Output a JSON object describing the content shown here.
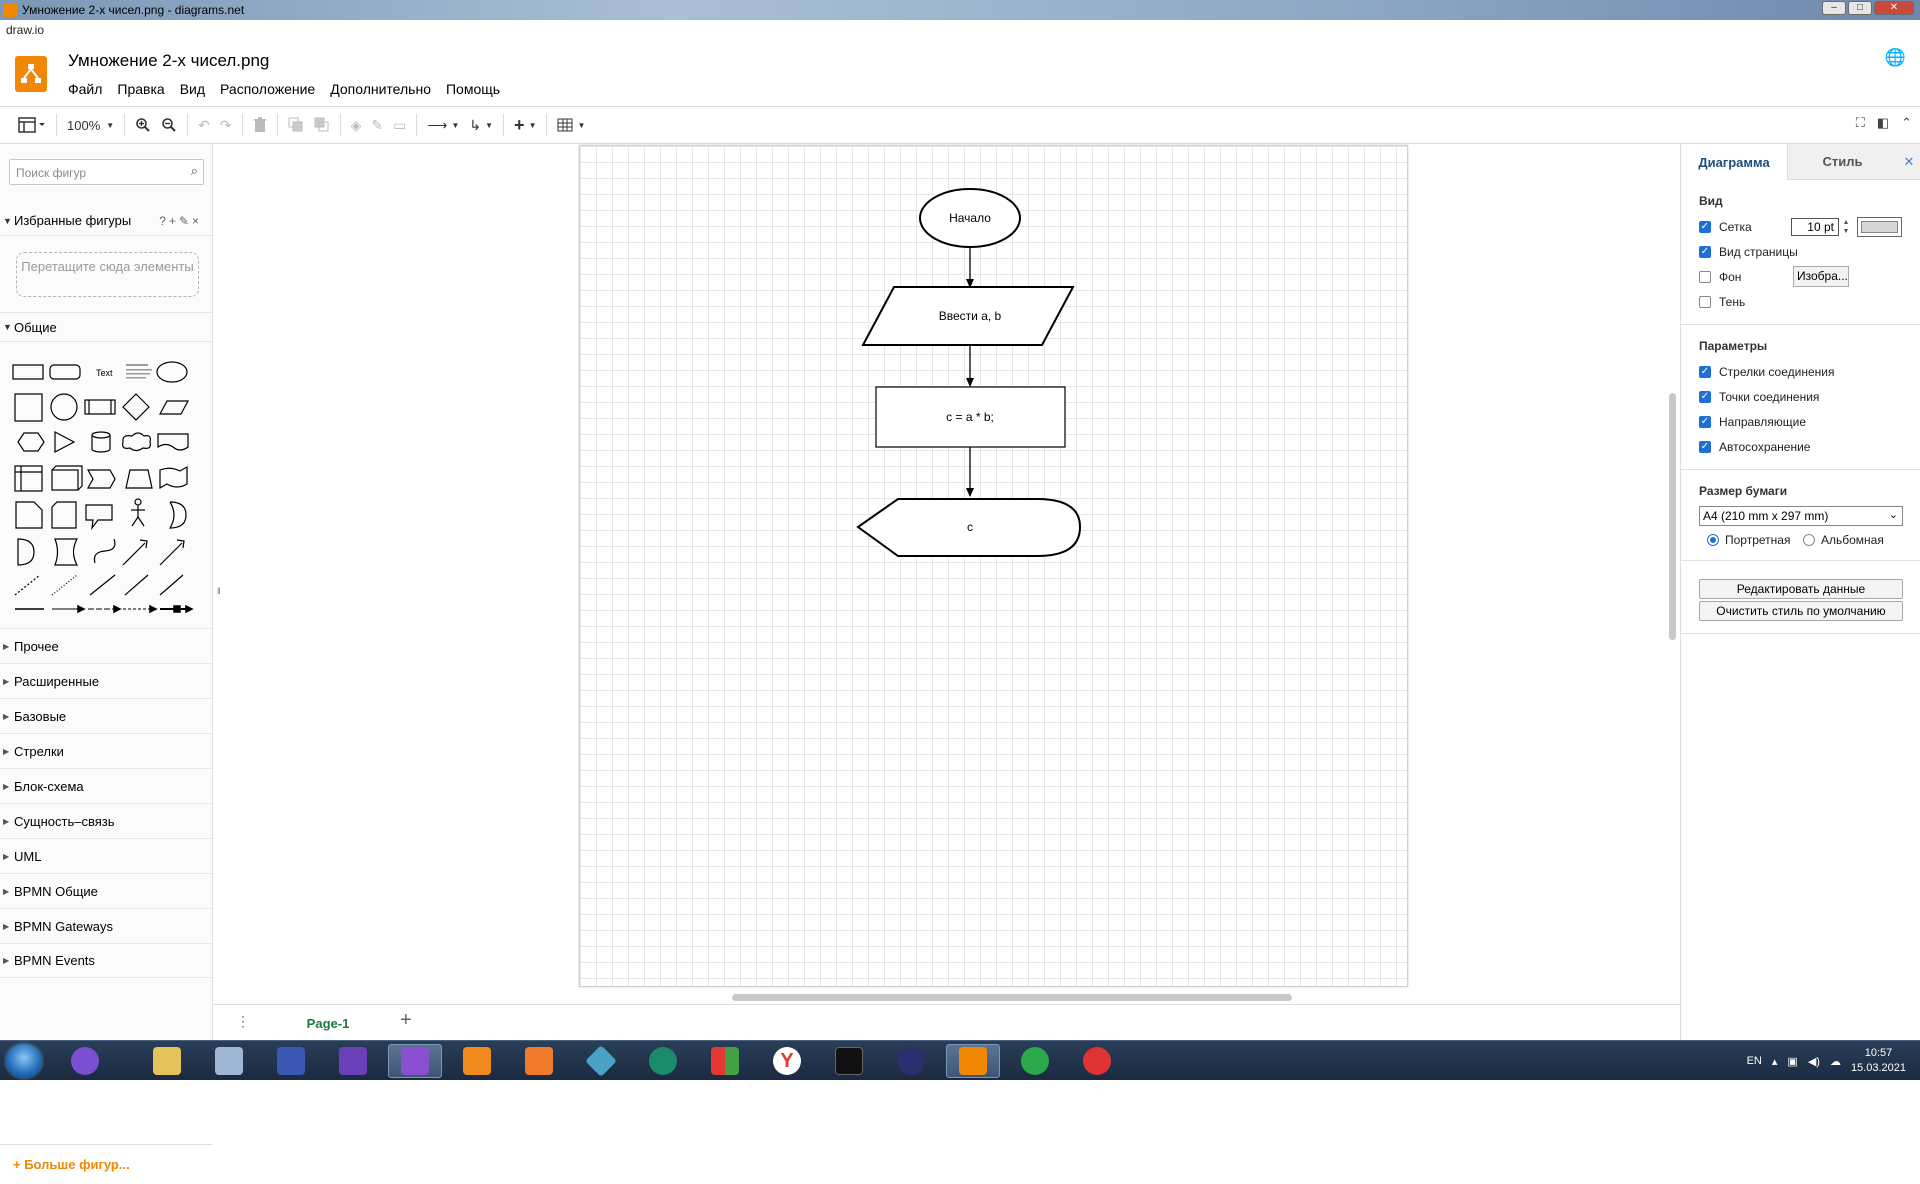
{
  "window": {
    "title": "Умножение 2-х чисел.png - diagrams.net",
    "domain": "draw.io"
  },
  "header": {
    "doc_title": "Умножение 2-х чисел.png",
    "menu": [
      "Файл",
      "Правка",
      "Вид",
      "Расположение",
      "Дополнительно",
      "Помощь"
    ]
  },
  "toolbar": {
    "zoom": "100%"
  },
  "sidebar": {
    "search_placeholder": "Поиск фигур",
    "favorites_title": "Избранные фигуры",
    "favorites_tools": "?+✎×",
    "drop_hint": "Перетащите сюда элементы",
    "general_title": "Общие",
    "shape_text_label": "Text",
    "collapsed_sections": [
      "Прочее",
      "Расширенные",
      "Базовые",
      "Стрелки",
      "Блок-схема",
      "Сущность–связь",
      "UML",
      "BPMN Общие",
      "BPMN Gateways",
      "BPMN Events"
    ],
    "more_shapes": "+ Больше фигур..."
  },
  "diagram": {
    "nodes": [
      {
        "type": "ellipse",
        "label": "Начало"
      },
      {
        "type": "parallelogram",
        "label": "Ввести a, b"
      },
      {
        "type": "rectangle",
        "label": "c = a * b;"
      },
      {
        "type": "display",
        "label": "c"
      }
    ]
  },
  "pages": {
    "tabs": [
      "Page-1"
    ]
  },
  "format_panel": {
    "tab_diagram": "Диаграмма",
    "tab_style": "Стиль",
    "view_title": "Вид",
    "view_options": [
      {
        "label": "Сетка",
        "checked": true
      },
      {
        "label": "Вид страницы",
        "checked": true
      },
      {
        "label": "Фон",
        "checked": false
      },
      {
        "label": "Тень",
        "checked": false
      }
    ],
    "grid_size": "10 pt",
    "grid_color": "#d7d7d7",
    "bg_image_button": "Изобра...",
    "params_title": "Параметры",
    "params": [
      {
        "label": "Стрелки соединения",
        "checked": true
      },
      {
        "label": "Точки соединения",
        "checked": true
      },
      {
        "label": "Направляющие",
        "checked": true
      },
      {
        "label": "Автосохранение",
        "checked": true
      }
    ],
    "paper_title": "Размер бумаги",
    "paper_size": "A4 (210 mm x 297 mm)",
    "orientation": [
      {
        "label": "Портретная",
        "selected": true
      },
      {
        "label": "Альбомная",
        "selected": false
      }
    ],
    "edit_data_button": "Редактировать данные",
    "clear_style_button": "Очистить стиль по умолчанию"
  },
  "taskbar": {
    "lang": "EN",
    "time": "10:57",
    "date": "15.03.2021"
  },
  "colors": {
    "accent": "#f08705",
    "page_tab": "#1a7a3e",
    "checkbox": "#1e6fd6"
  }
}
